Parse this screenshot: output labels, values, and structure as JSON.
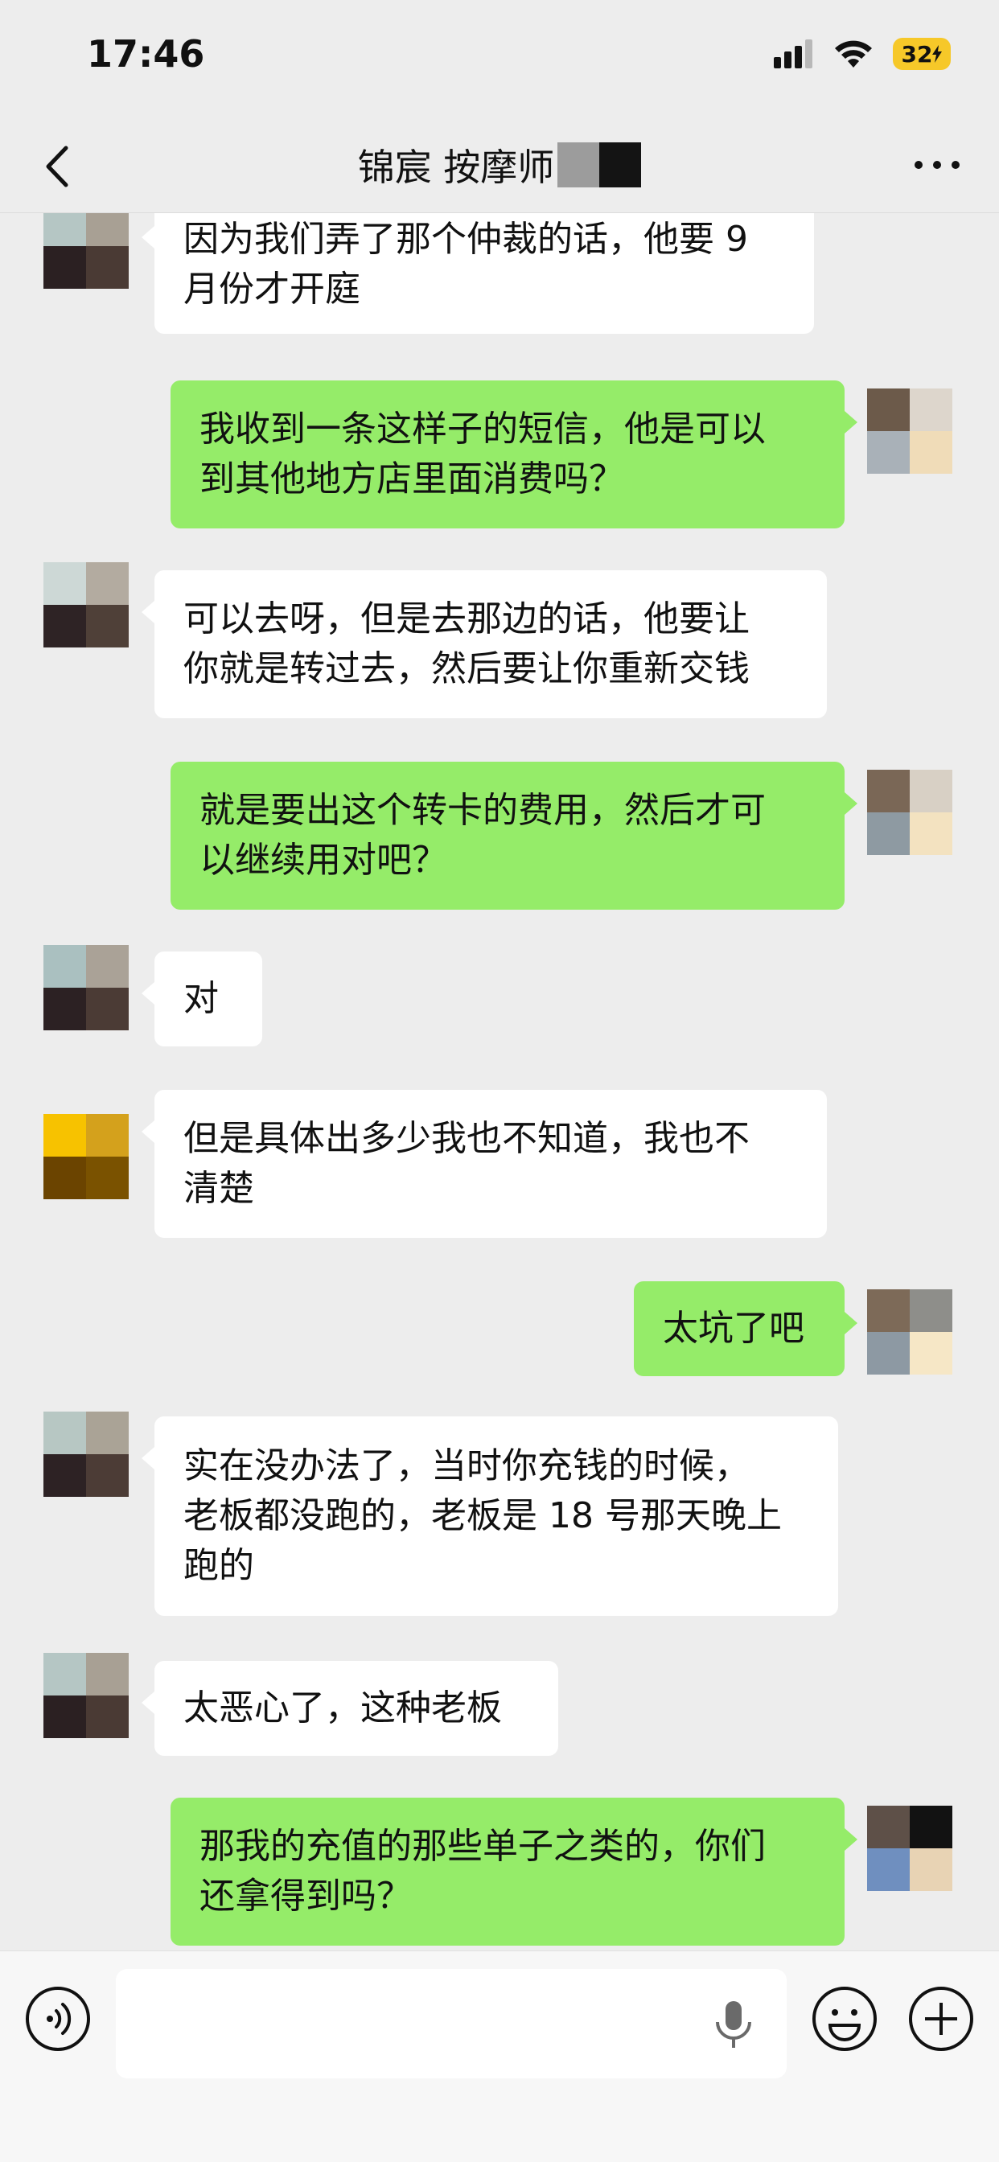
{
  "status_bar": {
    "time": "17:46",
    "battery": "32"
  },
  "header": {
    "title": "锦宸 按摩师"
  },
  "icons": {
    "back": "chevron-left-icon",
    "more": "more-horizontal-icon",
    "voice": "voice-icon",
    "mic": "microphone-icon",
    "emoji": "emoji-icon",
    "plus": "plus-icon"
  },
  "colors": {
    "outgoing_bubble": "#95ec69",
    "incoming_bubble": "#ffffff",
    "background": "#ededed"
  },
  "messages": [
    {
      "side": "in",
      "lines": [
        "因为我们弄了那个仲裁的话，他要 9",
        "月份才开庭"
      ]
    },
    {
      "side": "out",
      "lines": [
        "我收到一条这样子的短信，他是可以",
        "到其他地方店里面消费吗？"
      ]
    },
    {
      "side": "in",
      "lines": [
        "可以去呀，但是去那边的话，他要让",
        "你就是转过去，然后要让你重新交钱"
      ]
    },
    {
      "side": "out",
      "lines": [
        "就是要出这个转卡的费用，然后才可",
        "以继续用对吧？"
      ]
    },
    {
      "side": "in",
      "lines": [
        "对"
      ]
    },
    {
      "side": "in",
      "lines": [
        "但是具体出多少我也不知道，我也不",
        "清楚"
      ]
    },
    {
      "side": "out",
      "lines": [
        "太坑了吧"
      ]
    },
    {
      "side": "in",
      "lines": [
        "实在没办法了，当时你充钱的时候，",
        "老板都没跑的，老板是 18 号那天晚上",
        "跑的"
      ]
    },
    {
      "side": "in",
      "lines": [
        "太恶心了，这种老板"
      ]
    },
    {
      "side": "out",
      "lines": [
        "那我的充值的那些单子之类的，你们",
        "还拿得到吗？"
      ]
    }
  ]
}
